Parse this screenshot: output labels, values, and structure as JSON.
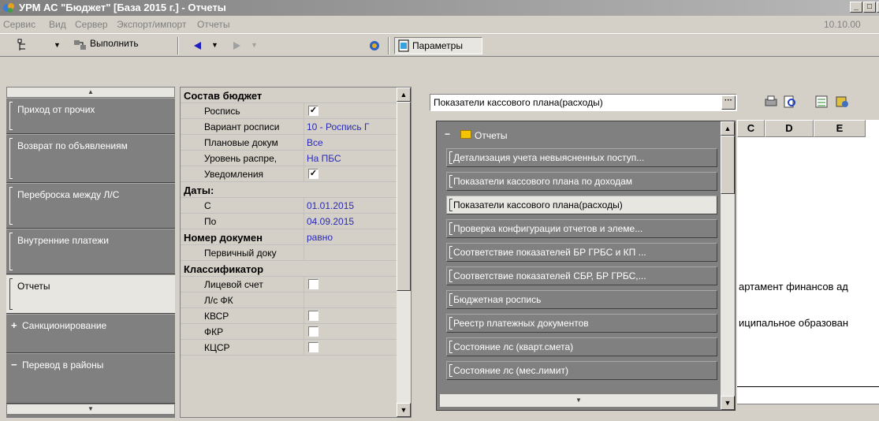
{
  "window": {
    "title": "УРМ АС \"Бюджет\" [База 2015 г.] - Отчеты"
  },
  "menu": {
    "items": [
      "Сервис",
      "Вид",
      "Сервер",
      "Экспорт/импорт",
      "Отчеты"
    ],
    "version": "10.10.00"
  },
  "toolbar": {
    "execute_label": "Выполнить",
    "params_label": "Параметры"
  },
  "nav": {
    "items": [
      {
        "label": "Приход от прочих"
      },
      {
        "label": "Возврат по объявлениям"
      },
      {
        "label": "Переброска между Л/С"
      },
      {
        "label": "Внутренние платежи"
      },
      {
        "label": "Отчеты"
      }
    ],
    "groups": [
      {
        "sign": "+",
        "label": "Санкционирование"
      },
      {
        "sign": "−",
        "label": "Перевод в районы"
      }
    ]
  },
  "properties": {
    "budget_cat": "Состав бюджет",
    "rospis": "Роспись",
    "variant": "Вариант росписи",
    "variant_val": "10 - Роспись Г",
    "plan_docs": "Плановые докум",
    "plan_docs_val": "Все",
    "level": "Уровень распре,",
    "level_val": "На ПБС",
    "notices": "Уведомления",
    "dates_cat": "Даты:",
    "date_from": "С",
    "date_from_val": "01.01.2015",
    "date_to": "По",
    "date_to_val": "04.09.2015",
    "docnum_cat": "Номер докумен",
    "docnum_val": "равно",
    "primary_doc": "Первичный доку",
    "class_cat": "Классификатор",
    "personal": "Лицевой счет",
    "ls_fk": "Л/с ФК",
    "kvsr": "КВСР",
    "fkr": "ФКР",
    "kcsr": "КЦСР"
  },
  "report": {
    "selected": "Показатели кассового плана(расходы)",
    "columns": [
      "C",
      "D",
      "E"
    ],
    "sheet_text_1": "артамент финансов ад",
    "sheet_text_2": "иципальное образован"
  },
  "tree": {
    "root": "Отчеты",
    "items": [
      "Детализация учета невыясненных поступ...",
      "Показатели кассового плана по доходам",
      "Показатели кассового плана(расходы)",
      "Проверка конфигурации отчетов и элеме...",
      "Соответствие показателей БР ГРБС и КП ...",
      "Соответствие показателей СБР, БР ГРБС,...",
      "Бюджетная роспись",
      "Реестр платежных документов",
      "Состояние лс (кварт.смета)",
      "Состояние лс (мес.лимит)"
    ],
    "selected_index": 2
  },
  "colors": {
    "panel": "#808080",
    "selected": "#e8e6e0",
    "value_text": "#2a2ab8"
  }
}
